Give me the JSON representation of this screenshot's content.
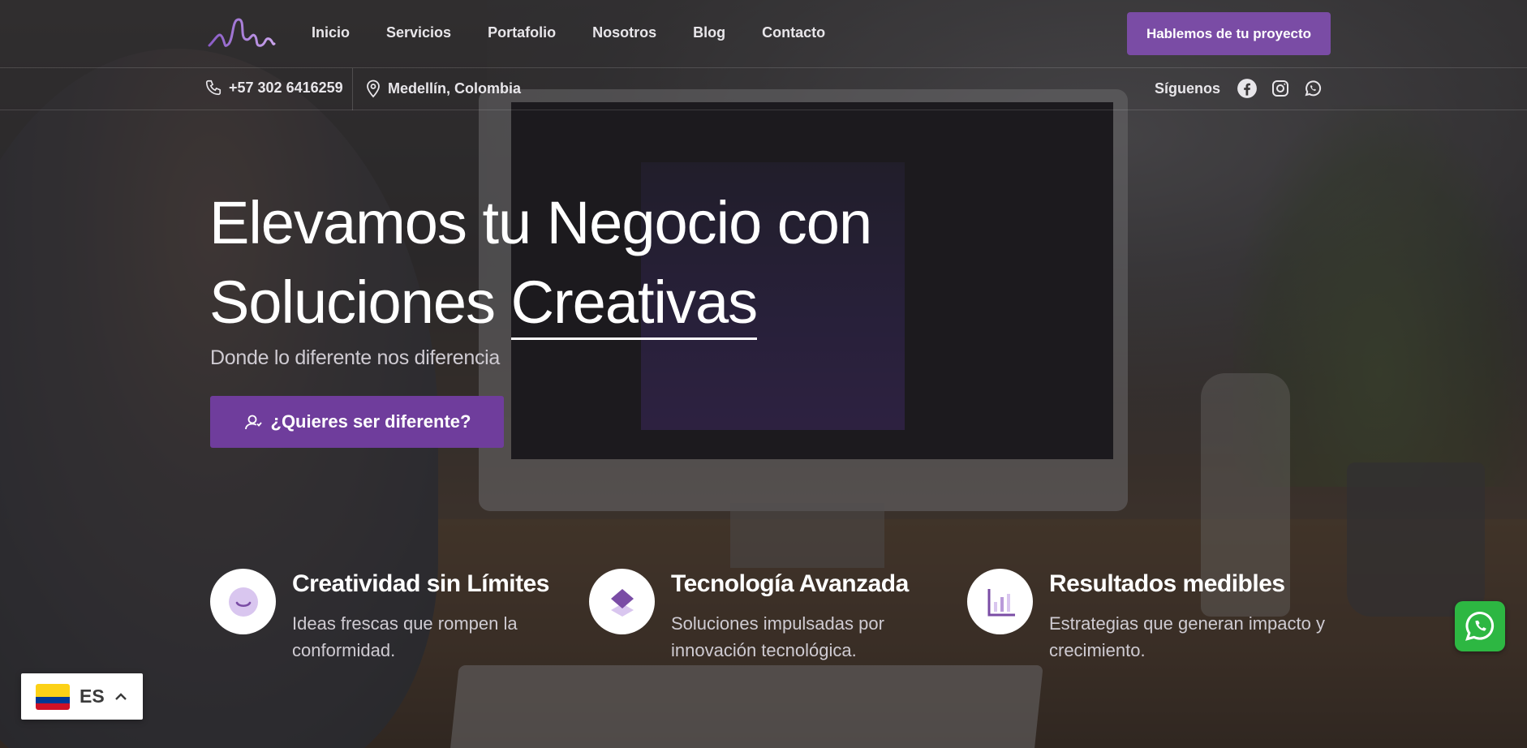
{
  "nav": {
    "menu": [
      "Inicio",
      "Servicios",
      "Portafolio",
      "Nosotros",
      "Blog",
      "Contacto"
    ],
    "cta_label": "Hablemos de tu proyecto"
  },
  "subbar": {
    "phone": "+57 302 6416259",
    "location": "Medellín, Colombia",
    "follow_label": "Síguenos",
    "social_icons": [
      "facebook-icon",
      "instagram-icon",
      "whatsapp-icon"
    ]
  },
  "hero": {
    "title_line1": "Elevamos tu Negocio con",
    "title_line2_prefix": "Soluciones",
    "title_line2_accent": "Creativas",
    "subtitle": "Donde lo diferente nos diferencia",
    "button_label": "¿Quieres ser diferente?"
  },
  "features": [
    {
      "title": "Creatividad sin Límites",
      "desc": "Ideas frescas que rompen la conformidad.",
      "icon": "smile-icon"
    },
    {
      "title": "Tecnología Avanzada",
      "desc": "Soluciones impulsadas por innovación tecnológica.",
      "icon": "layers-icon"
    },
    {
      "title": "Resultados medibles",
      "desc": "Estrategias que generan impacto y crecimiento.",
      "icon": "bar-chart-icon"
    }
  ],
  "language": {
    "code": "ES"
  },
  "colors": {
    "accent": "#7a4ca5",
    "button": "#6f3d9c",
    "whatsapp": "#2db742"
  }
}
